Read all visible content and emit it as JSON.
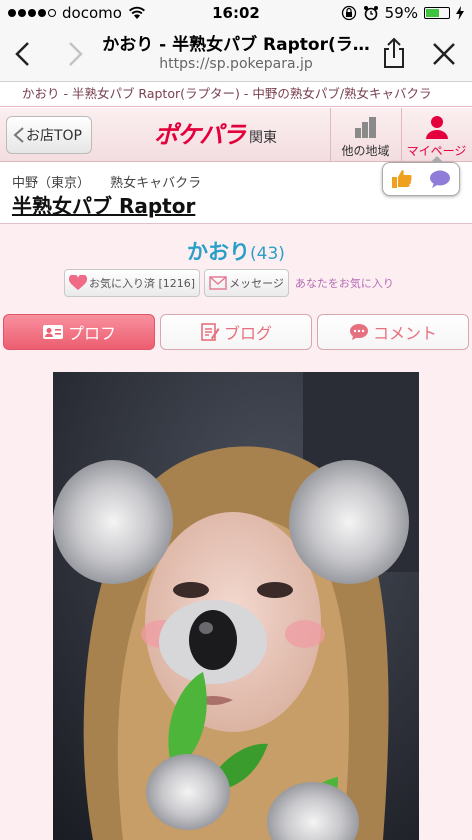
{
  "status_bar": {
    "carrier": "docomo",
    "time": "16:02",
    "battery": "59%",
    "battery_level": 0.59,
    "signal_bars_filled": 4
  },
  "browser": {
    "page_title": "かおり - 半熟女パブ Raptor(ラ…",
    "url": "sp.pokepara.jp",
    "back_icon": "chevron-left-icon",
    "forward_icon": "chevron-right-icon",
    "share_icon": "share-icon",
    "close_icon": "close-icon"
  },
  "breadcrumb": "かおり - 半熟女パブ Raptor(ラプター) - 中野の熟女パブ/熟女キャバクラ",
  "header": {
    "back_label": "お店TOP",
    "logo_text": "ポケパラ",
    "region": "関東",
    "area_label": "他の地域",
    "mypage_label": "マイページ"
  },
  "shop": {
    "area": "中野（東京）",
    "category": "熟女キャバクラ",
    "name": "半熟女パブ Raptor"
  },
  "profile": {
    "name": "かおり",
    "age": "(43)",
    "favorite_label": "お気に入り済 [1216]",
    "message_label": "メッセージ",
    "favorited_you_label": "あなたをお気に入り"
  },
  "tabs": [
    {
      "label": "プロフ",
      "active": true
    },
    {
      "label": "ブログ",
      "active": false
    },
    {
      "label": "コメント",
      "active": false
    }
  ],
  "colors": {
    "brand_red": "#e4003c",
    "tab_active": "#ec5e70",
    "name_blue": "#2aa0c8",
    "page_bg": "#fdeff1"
  }
}
